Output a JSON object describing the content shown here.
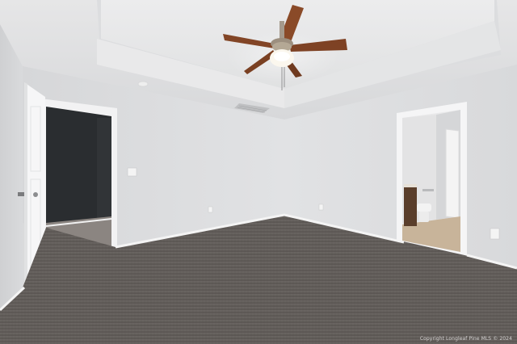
{
  "scene": {
    "room": "empty bedroom",
    "objects": [
      "ceiling-fan",
      "tray-ceiling",
      "open-door",
      "closet",
      "bathroom-doorway",
      "carpet-floor"
    ]
  },
  "watermark": {
    "text": "Copyright Longleaf Pine MLS © 2024"
  },
  "colors": {
    "wall": "#dcdddf",
    "ceiling": "#e2e3e4",
    "carpet": "#5f5a57",
    "closet_wall": "#2a2d30",
    "fan_blade": "#8a4a28",
    "trim": "#f4f4f4"
  }
}
